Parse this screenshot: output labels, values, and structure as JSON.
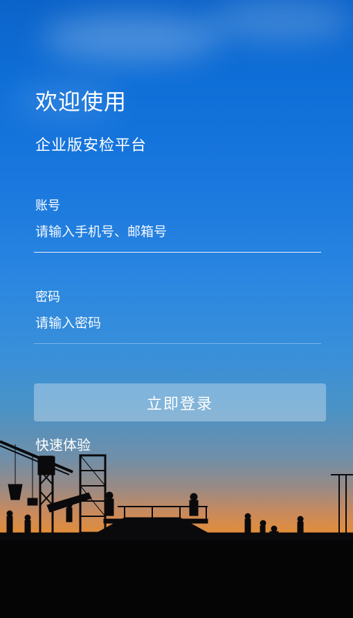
{
  "welcome": {
    "title": "欢迎使用",
    "subtitle": "企业版安检平台"
  },
  "form": {
    "account_label": "账号",
    "account_placeholder": "请输入手机号、邮箱号",
    "password_label": "密码",
    "password_placeholder": "请输入密码",
    "login_button": "立即登录",
    "quick_experience": "快速体验"
  },
  "colors": {
    "sky_top": "#0b63c9",
    "horizon": "#e08d3c",
    "ground": "#050506"
  }
}
